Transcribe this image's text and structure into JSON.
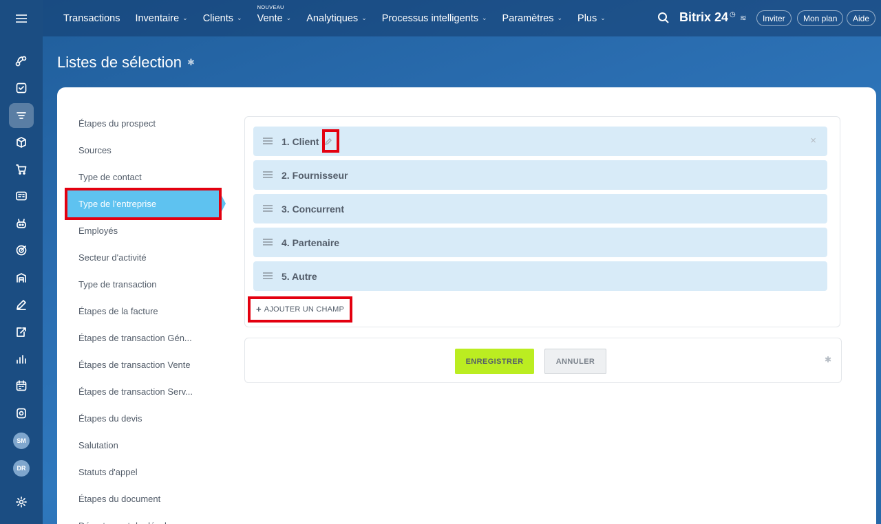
{
  "topbar": {
    "nav": [
      {
        "label": "Transactions",
        "chevron": false,
        "badge": ""
      },
      {
        "label": "Inventaire",
        "chevron": true,
        "badge": ""
      },
      {
        "label": "Clients",
        "chevron": true,
        "badge": ""
      },
      {
        "label": "Vente",
        "chevron": true,
        "badge": "NOUVEAU"
      },
      {
        "label": "Analytiques",
        "chevron": true,
        "badge": ""
      },
      {
        "label": "Processus intelligents",
        "chevron": true,
        "badge": ""
      },
      {
        "label": "Paramètres",
        "chevron": true,
        "badge": ""
      },
      {
        "label": "Plus",
        "chevron": true,
        "badge": ""
      }
    ],
    "brand": "Bitrix 24",
    "invite_label": "Inviter",
    "plan_label": "Mon plan",
    "help_label": "Aide"
  },
  "rail": {
    "avatars": [
      "SM",
      "DR"
    ]
  },
  "page": {
    "title": "Listes de sélection"
  },
  "sidebar": {
    "items": [
      "Étapes du prospect",
      "Sources",
      "Type de contact",
      "Type de l'entreprise",
      "Employés",
      "Secteur d'activité",
      "Type de transaction",
      "Étapes de la facture",
      "Étapes de transaction Gén...",
      "Étapes de transaction Vente",
      "Étapes de transaction Serv...",
      "Étapes du devis",
      "Salutation",
      "Statuts d'appel",
      "Étapes du document",
      "Département de développ..."
    ],
    "active_index": 3
  },
  "list": {
    "rows": [
      "1. Client",
      "2. Fournisseur",
      "3. Concurrent",
      "4. Partenaire",
      "5. Autre"
    ],
    "add_field_label": "AJOUTER UN CHAMP"
  },
  "footer": {
    "save_label": "ENREGISTRER",
    "cancel_label": "ANNULER"
  },
  "colors": {
    "active_item": "#5ec2f0",
    "row_bg": "#d8ebf8",
    "save_button": "#bbed21",
    "highlight": "#e3000f"
  }
}
